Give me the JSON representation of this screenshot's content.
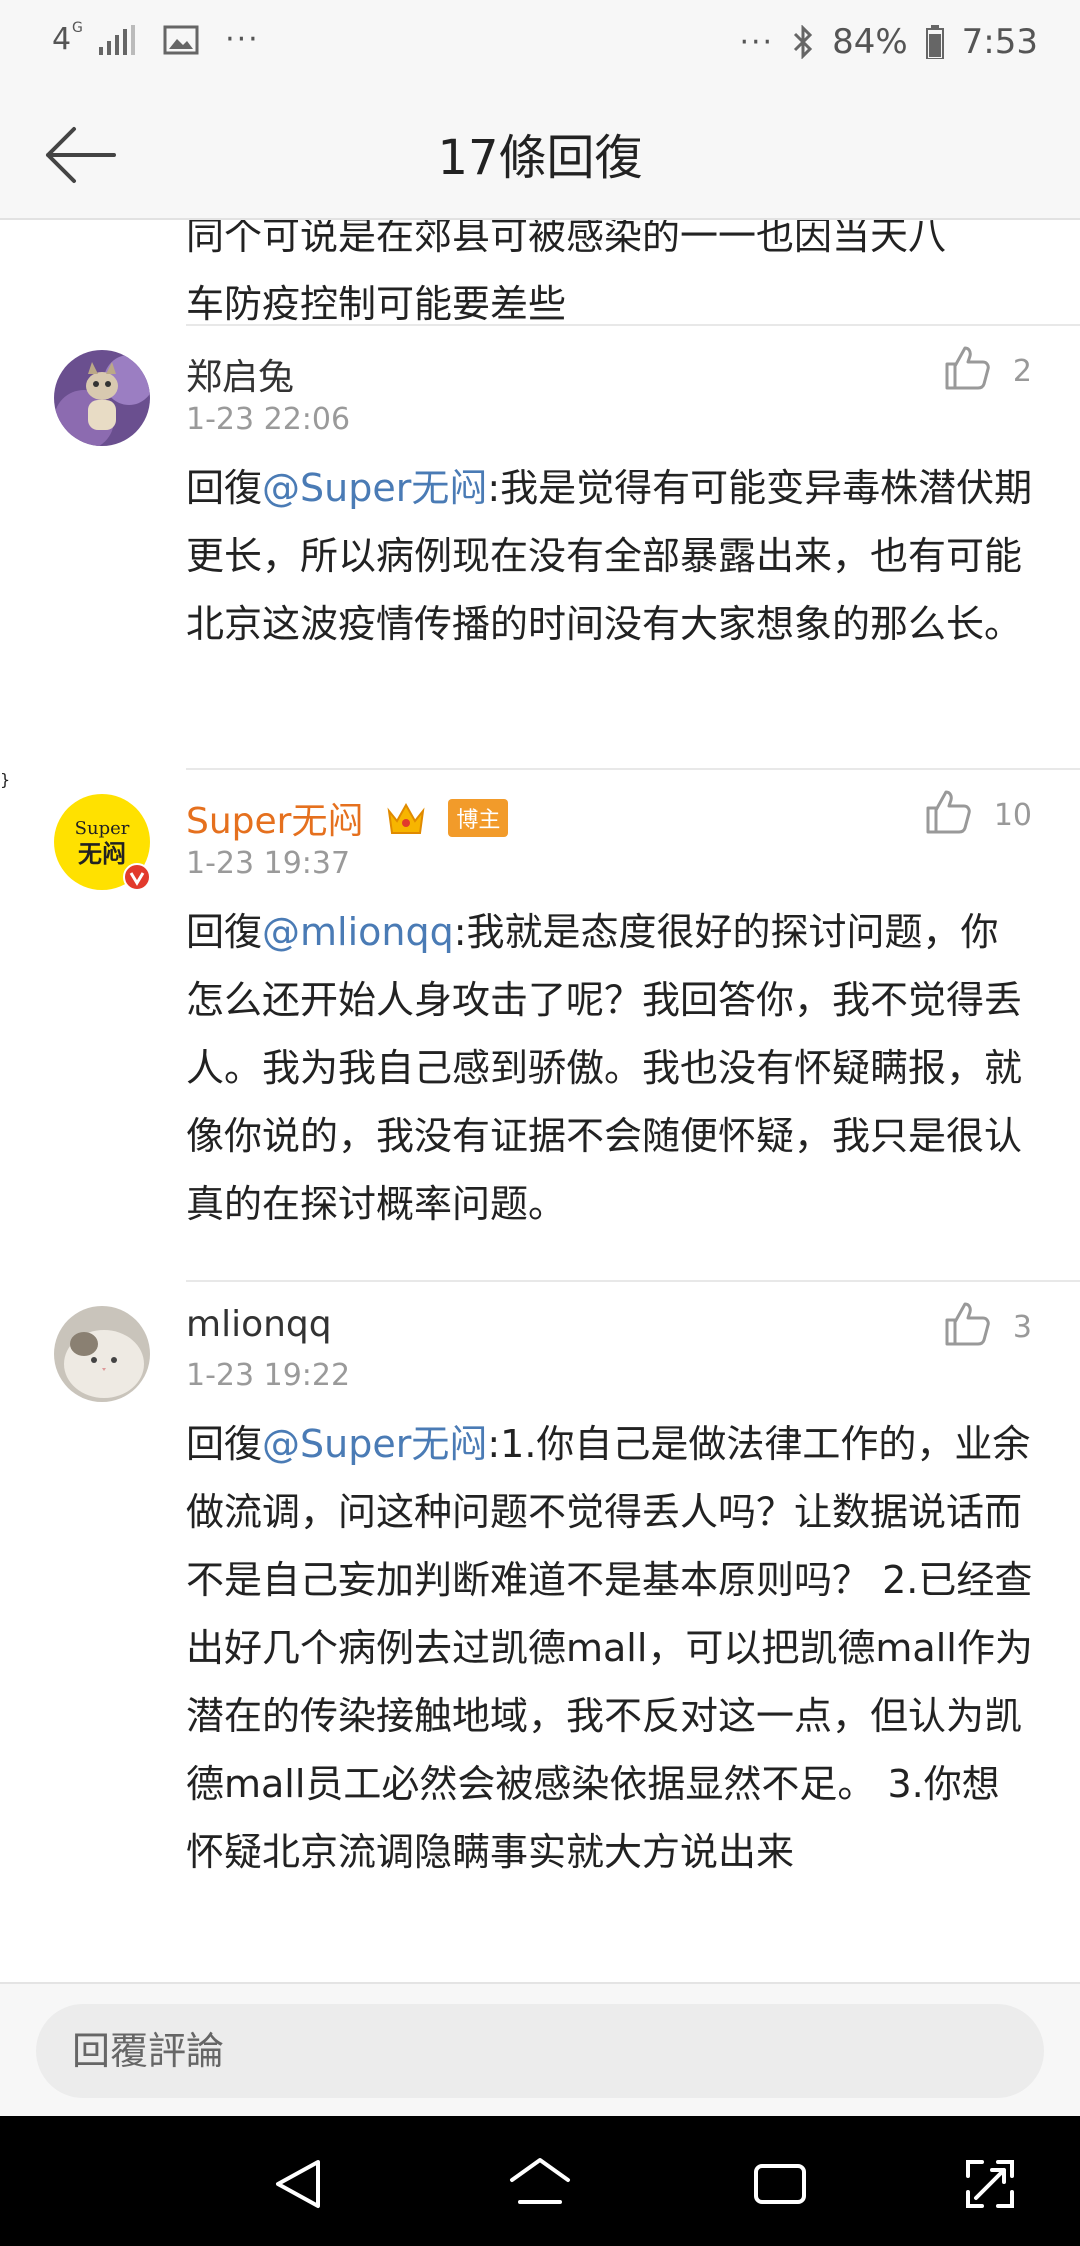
{
  "status": {
    "network": "4G",
    "battery": "84%",
    "time": "7:53"
  },
  "header": {
    "title": "17條回復"
  },
  "partial_top": {
    "line1": "同个可说是在郊县可被感染的一一也因当天八",
    "line2": "车防疫控制可能要差些"
  },
  "comments": [
    {
      "user": "郑启兔",
      "time": "1-23 22:06",
      "likes": "2",
      "reply_prefix": "回復",
      "mention": "@Super无闷",
      "text": ":我是觉得有可能变异毒株潜伏期更长，所以病例现在没有全部暴露出来，也有可能北京这波疫情传播的时间没有大家想象的那么长。"
    },
    {
      "user": "Super无闷",
      "badge": "博主",
      "avatar_text1": "Super",
      "avatar_text2": "无闷",
      "time": "1-23 19:37",
      "likes": "10",
      "reply_prefix": "回復",
      "mention": "@mlionqq",
      "text": ":我就是态度很好的探讨问题，你怎么还开始人身攻击了呢？我回答你，我不觉得丢人。我为我自己感到骄傲。我也没有怀疑瞒报，就像你说的，我没有证据不会随便怀疑，我只是很认真的在探讨概率问题。"
    },
    {
      "user": "mlionqq",
      "time": "1-23 19:22",
      "likes": "3",
      "reply_prefix": "回復",
      "mention": "@Super无闷",
      "text": ":1.你自己是做法律工作的，业余做流调，问这种问题不觉得丢人吗？让数据说话而不是自己妄加判断难道不是基本原则吗？ 2.已经查出好几个病例去过凯德mall，可以把凯德mall作为潜在的传染接触地域，我不反对这一点，但认为凯德mall员工必然会被感染依据显然不足。 3.你想怀疑北京流调隐瞒事实就大方说出来"
    }
  ],
  "reply_bar": {
    "placeholder": "回覆評論"
  },
  "icons": {
    "back": "arrow-left-icon",
    "like": "thumbs-up-icon",
    "crown": "crown-icon",
    "verified": "verified-icon",
    "nav": [
      "back-triangle-icon",
      "home-icon",
      "recents-icon",
      "fullscreen-icon"
    ]
  },
  "colors": {
    "owner_name": "#e5701e",
    "mention": "#4a7bb5",
    "badge": "#f29b2a"
  }
}
